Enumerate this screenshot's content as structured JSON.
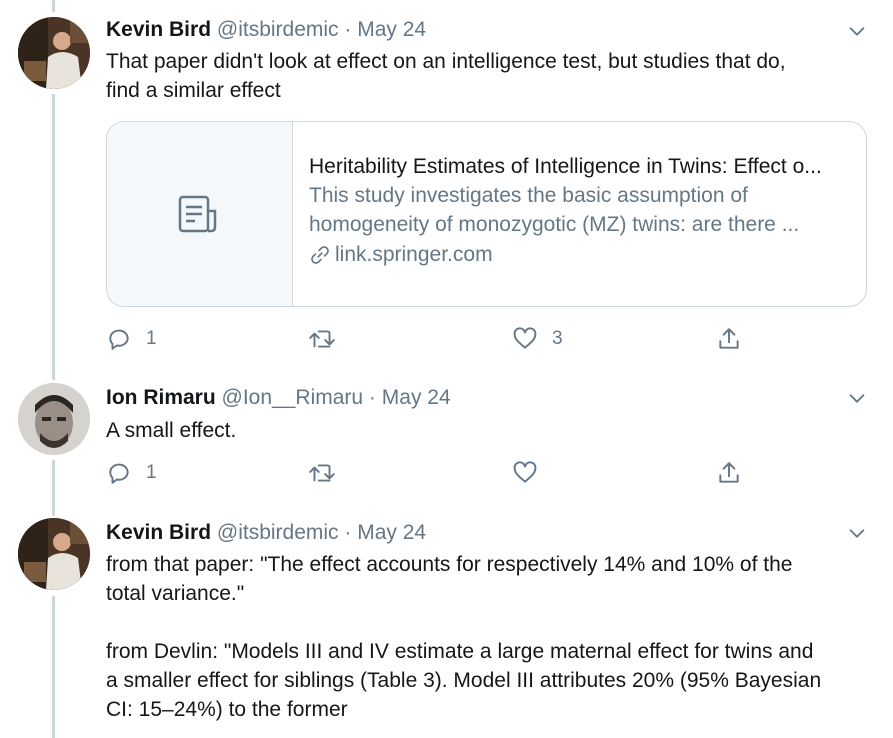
{
  "tweets": [
    {
      "name": "Kevin Bird",
      "handle": "@itsbirdemic",
      "separator": "·",
      "date": "May 24",
      "lines": [
        "That paper didn't look at effect on an intelligence test, but studies that do,",
        "find a similar effect"
      ],
      "card": {
        "title": "Heritability Estimates of Intelligence in Twins: Effect o...",
        "desc_lines": [
          "This study investigates the basic assumption of",
          "homogeneity of monozygotic (MZ) twins: are there ..."
        ],
        "domain": "link.springer.com",
        "icon": "article-icon"
      },
      "actions": {
        "reply_count": "1",
        "retweet_count": "",
        "like_count": "3"
      }
    },
    {
      "name": "Ion Rimaru",
      "handle": "@Ion__Rimaru",
      "separator": "·",
      "date": "May 24",
      "lines": [
        "A small effect."
      ],
      "actions": {
        "reply_count": "1",
        "retweet_count": "",
        "like_count": ""
      }
    },
    {
      "name": "Kevin Bird",
      "handle": "@itsbirdemic",
      "separator": "·",
      "date": "May 24",
      "lines": [
        "from that paper: \"The effect accounts for respectively 14% and 10% of the",
        "total variance.\"",
        "",
        "from Devlin: \"Models III and IV estimate a large maternal effect for twins and",
        "a smaller effect for siblings (Table 3). Model III attributes 20% (95% Bayesian",
        "CI: 15–24%) to the former"
      ]
    }
  ],
  "icons": {
    "reply": "reply-icon",
    "retweet": "retweet-icon",
    "like": "heart-icon",
    "share": "share-icon",
    "more": "chevron-down-icon",
    "link": "link-icon"
  },
  "colors": {
    "text": "#14171a",
    "secondary": "#657786",
    "border": "#ccd6dd",
    "thread": "#ccd6dd"
  }
}
